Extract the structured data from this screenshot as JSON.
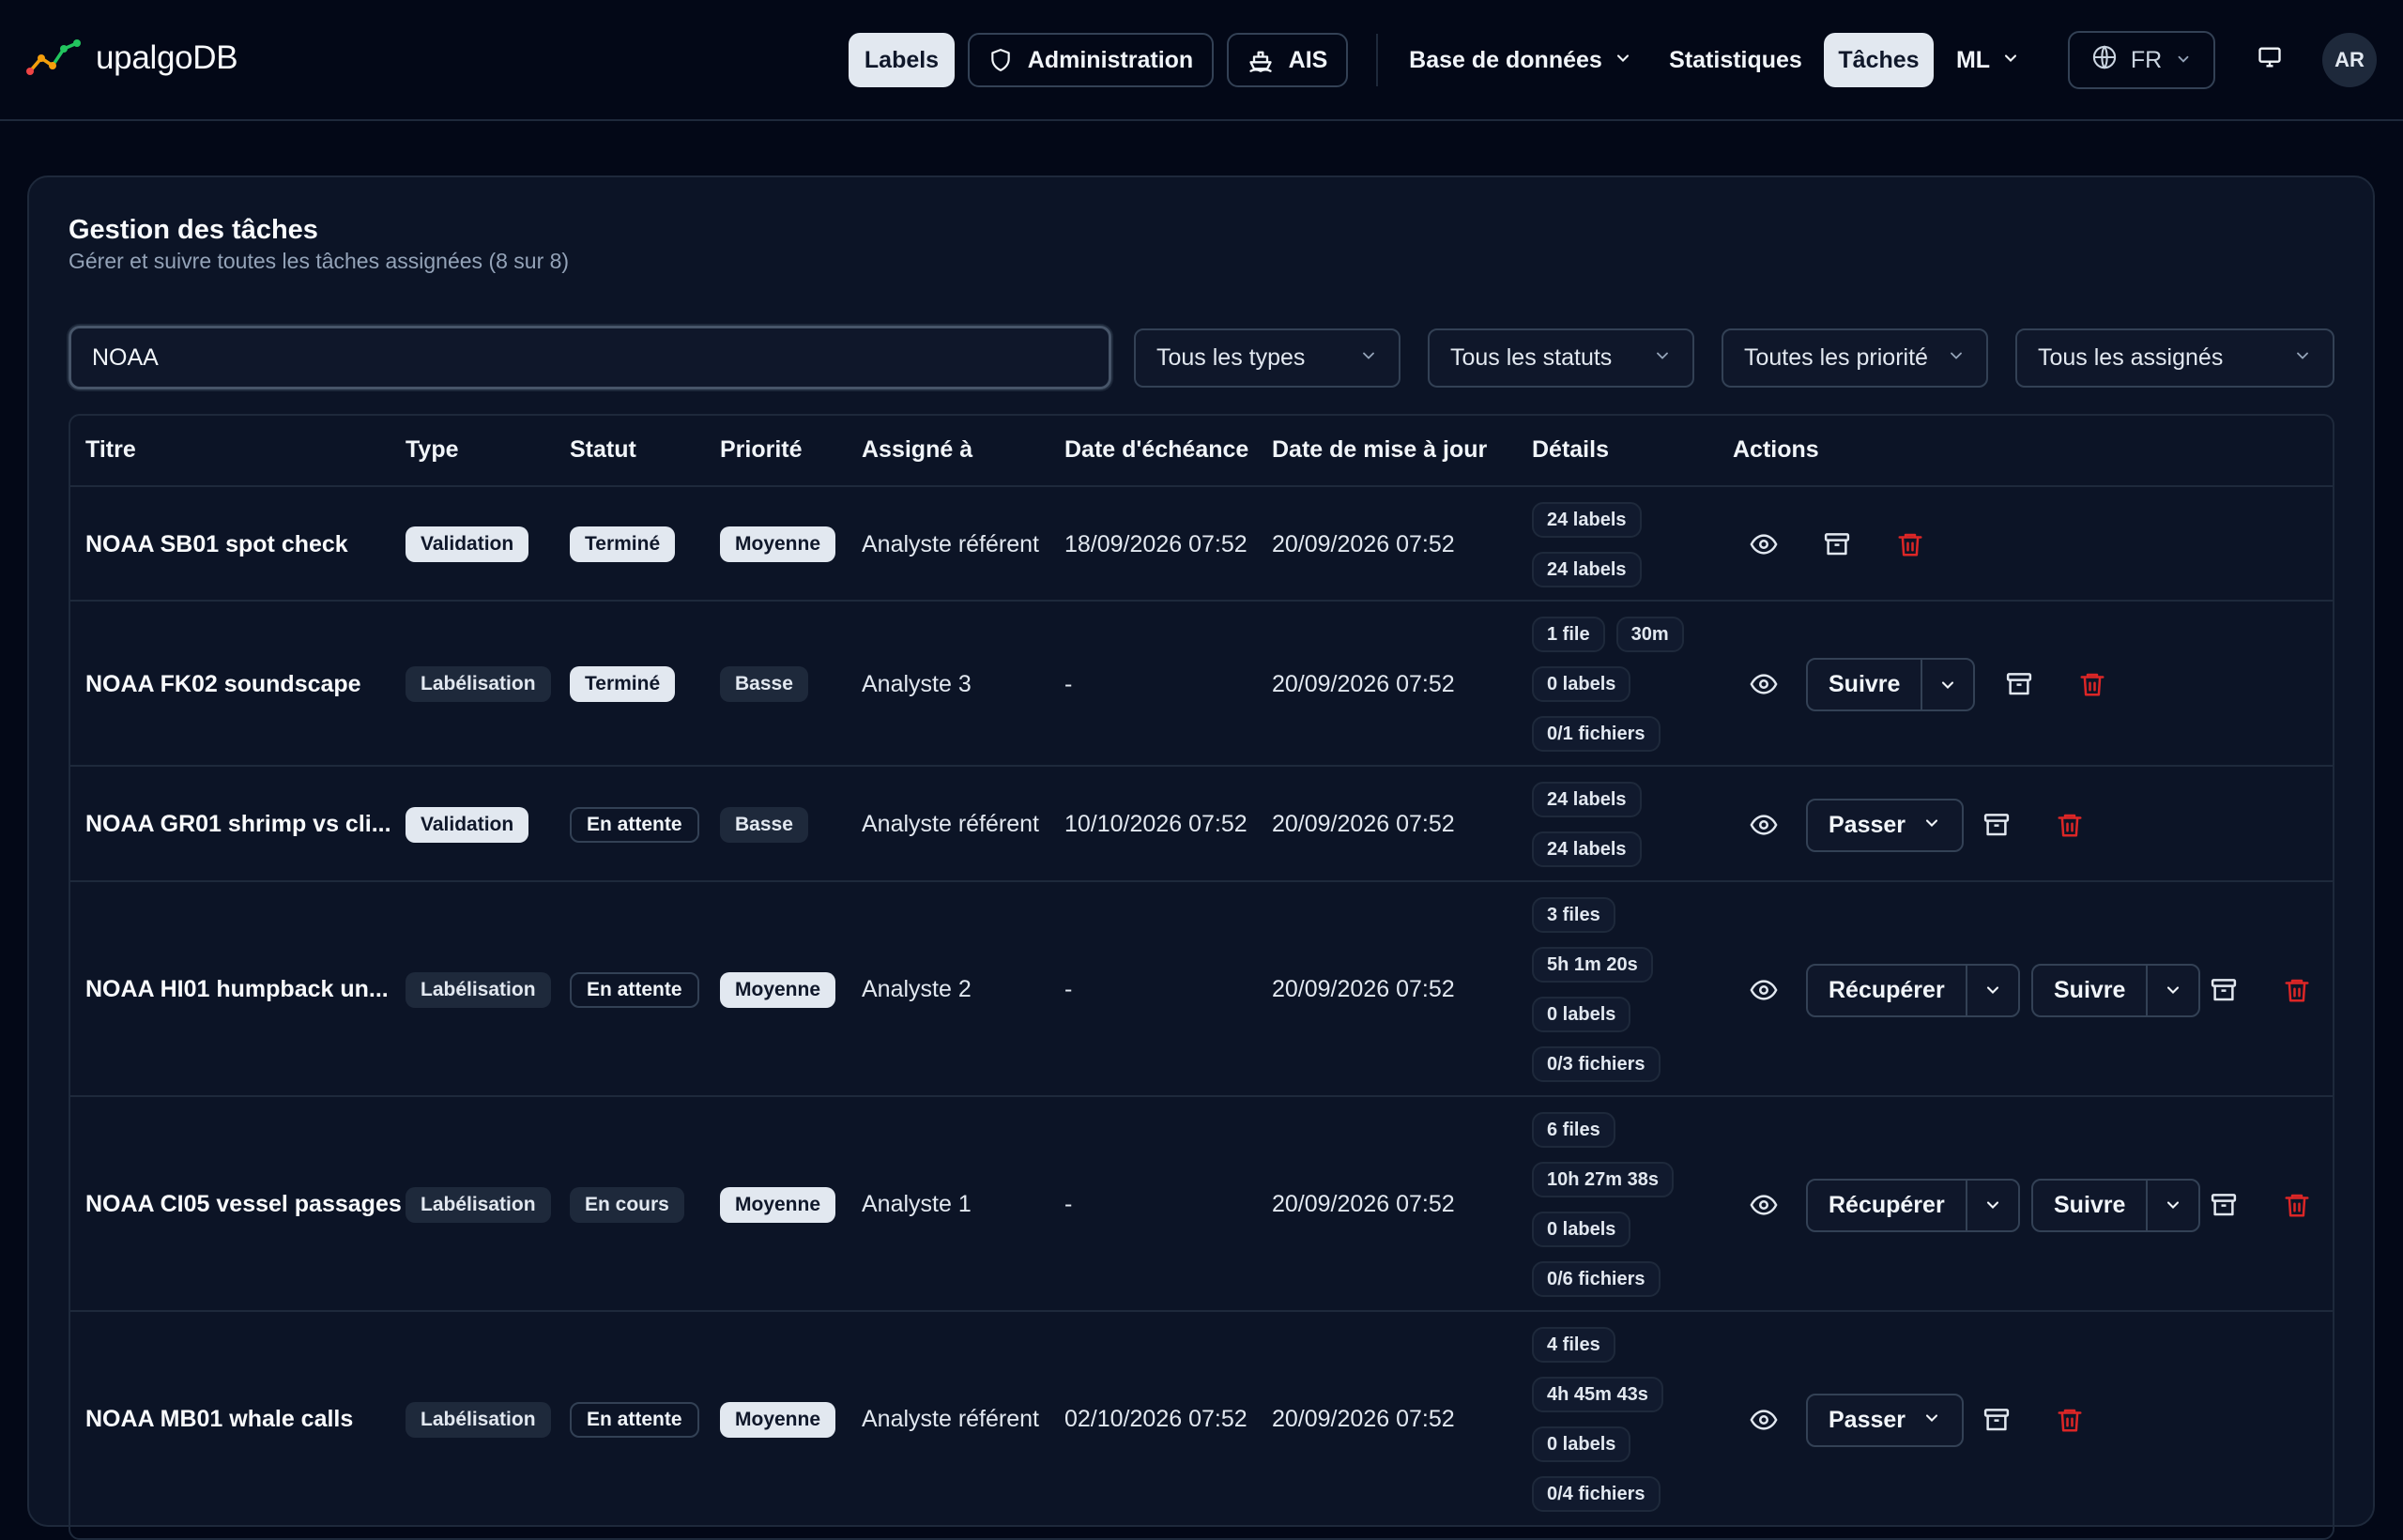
{
  "app": {
    "name": "upalgoDB"
  },
  "nav": {
    "labels": "Labels",
    "administration": "Administration",
    "ais": "AIS",
    "database": "Base de données",
    "statistics": "Statistiques",
    "tasks": "Tâches",
    "ml": "ML",
    "language": "FR",
    "avatar": "AR"
  },
  "page": {
    "title": "Gestion des tâches",
    "subtitle": "Gérer et suivre toutes les tâches assignées (8 sur 8)"
  },
  "filters": {
    "search_value": "NOAA",
    "types": "Tous les types",
    "statuses": "Tous les statuts",
    "priorities": "Toutes les priorité",
    "assignees": "Tous les assignés"
  },
  "table": {
    "headers": {
      "title": "Titre",
      "type": "Type",
      "status": "Statut",
      "priority": "Priorité",
      "assignee": "Assigné à",
      "due": "Date d'échéance",
      "updated": "Date de mise à jour",
      "details": "Détails",
      "actions": "Actions"
    },
    "rows": [
      {
        "title": "NOAA SB01 spot check",
        "type": "Validation",
        "status": "Terminé",
        "priority": "Moyenne",
        "assignee": "Analyste référent",
        "due": "18/09/2026 07:52",
        "updated": "20/09/2026 07:52",
        "details": [
          [
            "24 labels"
          ],
          [
            "24 labels"
          ]
        ],
        "buttons": []
      },
      {
        "title": "NOAA FK02 soundscape",
        "type": "Labélisation",
        "status": "Terminé",
        "priority": "Basse",
        "assignee": "Analyste 3",
        "due": "-",
        "updated": "20/09/2026 07:52",
        "details": [
          [
            "1 file",
            "30m"
          ],
          [
            "0 labels"
          ],
          [
            "0/1 fichiers"
          ]
        ],
        "buttons": [
          "Suivre"
        ]
      },
      {
        "title": "NOAA GR01 shrimp vs cli...",
        "type": "Validation",
        "status": "En attente",
        "priority": "Basse",
        "assignee": "Analyste référent",
        "due": "10/10/2026 07:52",
        "updated": "20/09/2026 07:52",
        "details": [
          [
            "24 labels"
          ],
          [
            "24 labels"
          ]
        ],
        "buttons": [
          "Passer"
        ]
      },
      {
        "title": "NOAA HI01 humpback un...",
        "type": "Labélisation",
        "status": "En attente",
        "priority": "Moyenne",
        "assignee": "Analyste 2",
        "due": "-",
        "updated": "20/09/2026 07:52",
        "details": [
          [
            "3 files"
          ],
          [
            "5h 1m 20s"
          ],
          [
            "0 labels"
          ],
          [
            "0/3 fichiers"
          ]
        ],
        "buttons": [
          "Récupérer",
          "Suivre"
        ]
      },
      {
        "title": "NOAA CI05 vessel passages",
        "type": "Labélisation",
        "status": "En cours",
        "priority": "Moyenne",
        "assignee": "Analyste 1",
        "due": "-",
        "updated": "20/09/2026 07:52",
        "details": [
          [
            "6 files"
          ],
          [
            "10h 27m 38s"
          ],
          [
            "0 labels"
          ],
          [
            "0/6 fichiers"
          ]
        ],
        "buttons": [
          "Récupérer",
          "Suivre"
        ]
      },
      {
        "title": "NOAA MB01 whale calls",
        "type": "Labélisation",
        "status": "En attente",
        "priority": "Moyenne",
        "assignee": "Analyste référent",
        "due": "02/10/2026 07:52",
        "updated": "20/09/2026 07:52",
        "details": [
          [
            "4 files"
          ],
          [
            "4h 45m 43s"
          ],
          [
            "0 labels"
          ],
          [
            "0/4 fichiers"
          ]
        ],
        "buttons": [
          "Passer"
        ]
      }
    ]
  },
  "colors": {
    "background": "#030817",
    "card": "#0c1426",
    "border": "#1e293b",
    "delete": "#dc2626",
    "logo_red": "#ef4444",
    "logo_orange": "#f59e0b",
    "logo_green": "#22c55e"
  },
  "icons": [
    "shield-icon",
    "ship-icon",
    "chevron-down-icon",
    "globe-icon",
    "monitor-icon",
    "eye-icon",
    "archive-icon",
    "trash-icon"
  ]
}
